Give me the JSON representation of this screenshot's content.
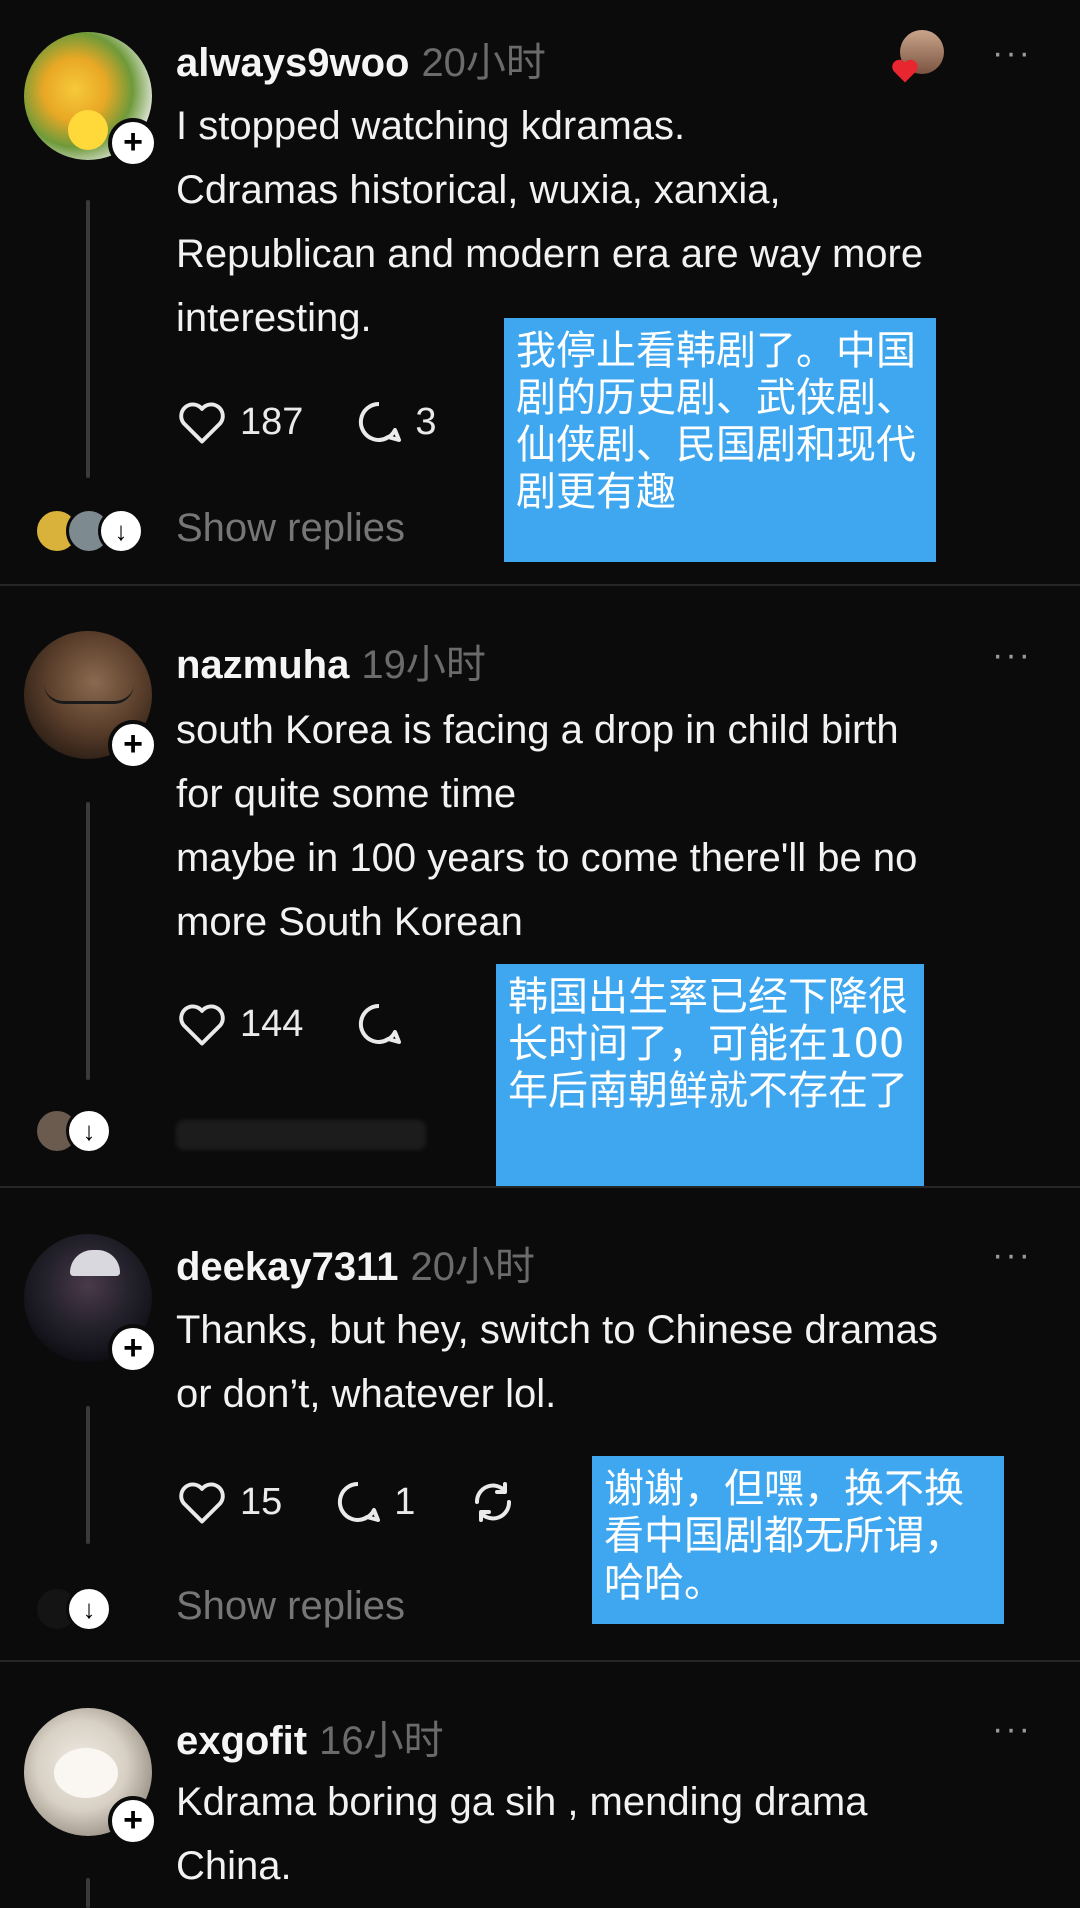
{
  "posts": [
    {
      "username": "always9woo",
      "time": "20小时",
      "more": "···",
      "lines": [
        "I stopped watching kdramas.",
        "Cdramas  historical,  wuxia, xanxia,",
        "Republican and modern era are way more",
        "interesting."
      ],
      "likes": "187",
      "replies": "3",
      "show_replies": "Show replies",
      "translation": "我停止看韩剧了。中国剧的历史剧、武侠剧、仙侠剧、民国剧和现代剧更有趣"
    },
    {
      "username": "nazmuha",
      "time": "19小时",
      "more": "···",
      "lines": [
        "south Korea is facing a drop in child birth",
        "for quite some time",
        "maybe in 100 years to come there'll be no",
        "more South Korean"
      ],
      "likes": "144",
      "translation": "韩国出生率已经下降很长时间了，可能在100年后南朝鲜就不存在了"
    },
    {
      "username": "deekay7311",
      "time": "20小时",
      "more": "···",
      "lines": [
        "Thanks, but hey, switch to Chinese dramas",
        "or don’t, whatever lol."
      ],
      "likes": "15",
      "replies": "1",
      "show_replies": "Show replies",
      "translation": "谢谢，但嘿，换不换看中国剧都无所谓，哈哈。"
    },
    {
      "username": "exgofit",
      "time": "16小时",
      "more": "···",
      "lines": [
        "Kdrama boring ga sih , mending drama",
        "China."
      ]
    }
  ],
  "icons": {
    "follow": "+",
    "expand": "↓",
    "like": "heart-icon",
    "reply": "reply-icon",
    "repost": "repost-icon"
  },
  "colors": {
    "background": "#0b0b0b",
    "translation_box": "#3fa7ef",
    "muted": "#6b6b6b",
    "heart_react": "#e8262f"
  }
}
